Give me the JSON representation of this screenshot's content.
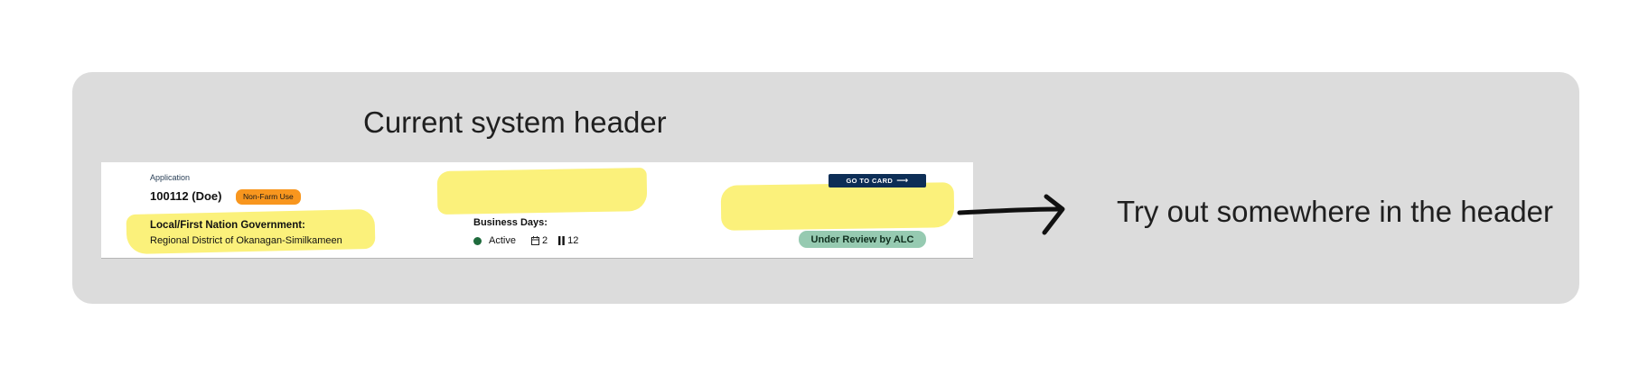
{
  "board": {
    "title": "Current system header",
    "note": "Try out somewhere in the header"
  },
  "header": {
    "application_label": "Application",
    "application_id": "100112 (Doe)",
    "type_badge": "Non-Farm Use",
    "government_label": "Local/First Nation Government:",
    "government_value": "Regional District of Okanagan-Similkameen",
    "business_days": {
      "label": "Business Days:",
      "status": "Active",
      "calendar_days": "2",
      "paused_days": "12"
    },
    "go_to_card_label": "GO TO CARD",
    "status_badge": "Under Review by ALC"
  },
  "icons": [
    "calendar-icon",
    "pause-icon",
    "arrow-right-icon"
  ],
  "colors": {
    "board_background": "#dcdcdc",
    "highlight": "#fbf17b",
    "type_badge": "#f8961e",
    "go_card_button": "#0d2e56",
    "status_badge": "#96cab1",
    "status_dot": "#1f6b3d"
  }
}
